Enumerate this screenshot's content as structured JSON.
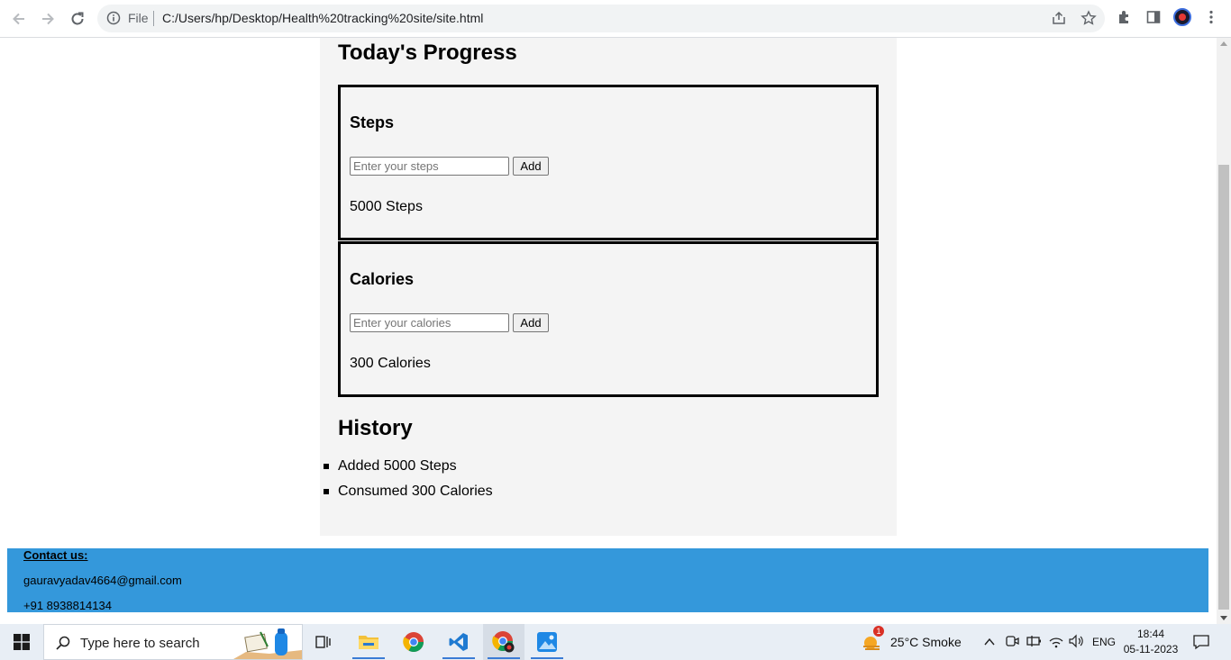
{
  "browser": {
    "file_label": "File",
    "url": "C:/Users/hp/Desktop/Health%20tracking%20site/site.html"
  },
  "page": {
    "progress_heading": "Today's Progress",
    "steps": {
      "title": "Steps",
      "placeholder": "Enter your steps",
      "button": "Add",
      "value": "5000 Steps"
    },
    "calories": {
      "title": "Calories",
      "placeholder": "Enter your calories",
      "button": "Add",
      "value": "300 Calories"
    },
    "history_heading": "History",
    "history": [
      "Added 5000 Steps",
      "Consumed 300 Calories"
    ],
    "footer": {
      "heading": "Contact us:",
      "email": "gauravyadav4664@gmail.com",
      "phone": "+91 8938814134"
    }
  },
  "taskbar": {
    "search_placeholder": "Type here to search",
    "weather": "25°C  Smoke",
    "weather_badge": "1",
    "language": "ENG",
    "time": "18:44",
    "date": "05-11-2023"
  },
  "colors": {
    "footer_bg": "#3498db",
    "card_bg": "#f4f4f4",
    "accent": "#3a7bd5"
  }
}
